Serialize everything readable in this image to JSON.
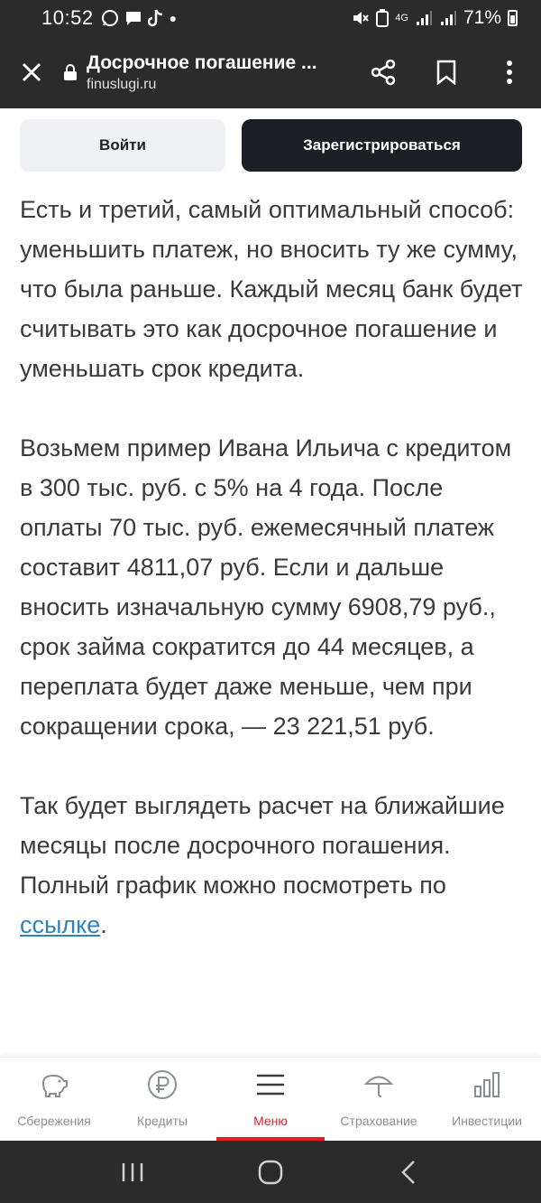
{
  "status_bar": {
    "time": "10:52",
    "battery": "71%",
    "network": "4G",
    "icons": [
      "whatsapp-icon",
      "message-icon",
      "tiktok-icon",
      "dot-icon",
      "mute-icon",
      "battery-saver-icon",
      "signal-icon",
      "signal-icon"
    ]
  },
  "browser": {
    "page_title": "Досрочное погашение ...",
    "domain": "finuslugi.ru"
  },
  "auth": {
    "login_label": "Войти",
    "register_label": "Зарегистрироваться"
  },
  "article": {
    "paragraphs": [
      "Есть и третий, самый оптимальный способ: уменьшить платеж, но вносить ту же сумму, что была раньше. Каждый месяц банк будет считывать это как досрочное погашение и уменьшать срок кредита.",
      "Возьмем пример Ивана Ильича с кредитом в 300 тыс. руб. с 5% на 4 года. После оплаты 70 тыс. руб. ежемесячный платеж составит 4811,07 руб. Если и дальше вносить изначальную сумму 6908,79 руб., срок займа сократится до 44 месяцев, а переплата будет даже меньше, чем при сокращении срока, — 23 221,51 руб."
    ],
    "last_paragraph_text": "Так будет выглядеть расчет на ближайшие месяцы после досрочного погашения. Полный график можно посмотреть по ",
    "link_text": "ссылке",
    "last_paragraph_end": "."
  },
  "bottom_nav": {
    "items": [
      {
        "label": "Сбережения",
        "icon": "piggy-bank-icon",
        "active": false
      },
      {
        "label": "Кредиты",
        "icon": "ruble-icon",
        "active": false
      },
      {
        "label": "Меню",
        "icon": "menu-icon",
        "active": true
      },
      {
        "label": "Страхование",
        "icon": "umbrella-icon",
        "active": false
      },
      {
        "label": "Инвестиции",
        "icon": "chart-icon",
        "active": false
      }
    ]
  },
  "colors": {
    "accent": "#e31e24",
    "dark_bar": "#2b2b2b",
    "link": "#2f83b7"
  }
}
